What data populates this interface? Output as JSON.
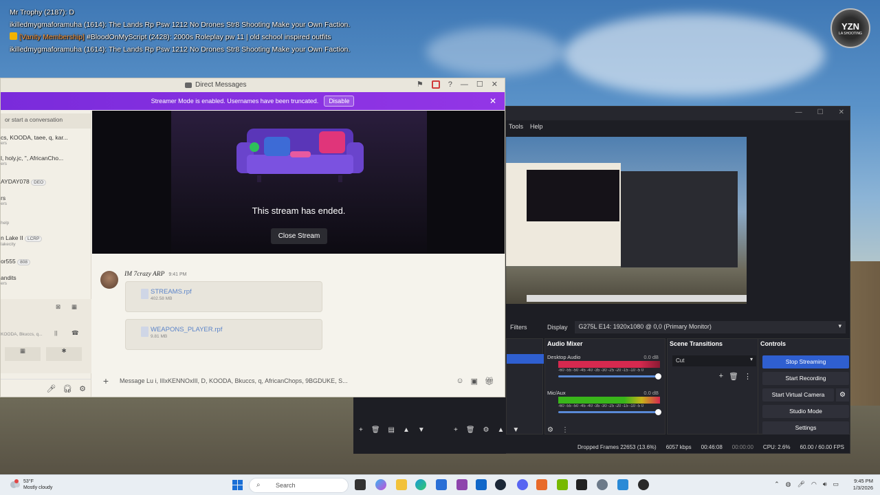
{
  "overlay_chat": [
    {
      "text": "Mr Trophy (2187): D"
    },
    {
      "text": "ikilledmygmaforamuha (1614): The Lands Rp Psw 1212 No Drones Str8 Shooting Make your Own Faction."
    },
    {
      "tag": "[Vanity Membership]",
      "text": "#BloodOnMyScript (2428): 2000s Roleplay pw 11 | old school inspired outfits"
    },
    {
      "text": "ikilledmygmaforamuha (1614): The Lands Rp Psw 1212 No Drones Str8 Shooting Make your Own Faction."
    }
  ],
  "logo_badge": {
    "main": "YZN",
    "sub": "LA SHOOTING"
  },
  "discord": {
    "title": "Direct Messages",
    "streamer_banner": "Streamer Mode is enabled. Usernames have been truncated.",
    "disable_label": "Disable",
    "search_placeholder": "or start a conversation",
    "sidebar": [
      {
        "line1": "cs, KOODA, taee, q, kar...",
        "line2": "ers"
      },
      {
        "line1": "l, holy.jc, \", AfricanCho...",
        "line2": "ers"
      },
      {
        "line1": "AYDAY078",
        "badge": "DEO"
      },
      {
        "line1": "rs",
        "line2": "ers"
      },
      {
        "line1": "",
        "line2": "help"
      },
      {
        "line1": "n Lake II",
        "badge": "LCRP",
        "line2": "lakecity"
      },
      {
        "line1": "or555",
        "badge": "808"
      },
      {
        "line1": "andits",
        "line2": "ers"
      }
    ],
    "sidebar_call_text": "KOODA, Bkuccs, q...",
    "stream_ended_text": "This stream has ended.",
    "close_stream_label": "Close Stream",
    "message": {
      "author": "IM 7crazy ARP",
      "time": "9:41 PM",
      "files": [
        {
          "name": "STREAMS.rpf",
          "size": "402.58 MB"
        },
        {
          "name": "WEAPONS_PLAYER.rpf",
          "size": "9.81 MB"
        }
      ]
    },
    "composer_placeholder": "Message Lu i, IlIxKENNOxIlI, D, KOODA, Bkuccs, q, AfricanChops, 9BGDUKE, S..."
  },
  "obs": {
    "menu": [
      "Tools",
      "Help"
    ],
    "filters_label": "Filters",
    "display_label": "Display",
    "display_value": "G275L E14: 1920x1080 @ 0,0 (Primary Monitor)",
    "audio_mixer_title": "Audio Mixer",
    "tracks": [
      {
        "name": "Desktop Audio",
        "db": "0.0 dB",
        "color": "#d6294f"
      },
      {
        "name": "Mic/Aux",
        "db": "0.0 dB",
        "color": "#39b51a"
      }
    ],
    "meter_scale": "-60 -55 -50 -45 -40 -35 -30 -25 -20 -15 -10 -5 0",
    "scene_transitions_title": "Scene Transitions",
    "transition_value": "Cut",
    "controls_title": "Controls",
    "controls": [
      "Stop Streaming",
      "Start Recording",
      "Start Virtual Camera",
      "Studio Mode",
      "Settings"
    ],
    "status": {
      "dropped": "Dropped Frames 22653 (13.6%)",
      "bitrate": "6057 kbps",
      "stream_time": "00:46:08",
      "rec_time": "00:00:00",
      "cpu": "CPU: 2.6%",
      "fps": "60.00 / 60.00 FPS"
    }
  },
  "taskbar": {
    "temp": "53°F",
    "weather": "Mostly cloudy",
    "search_label": "Search",
    "time": "9:45 PM",
    "date": "1/3/2026"
  }
}
